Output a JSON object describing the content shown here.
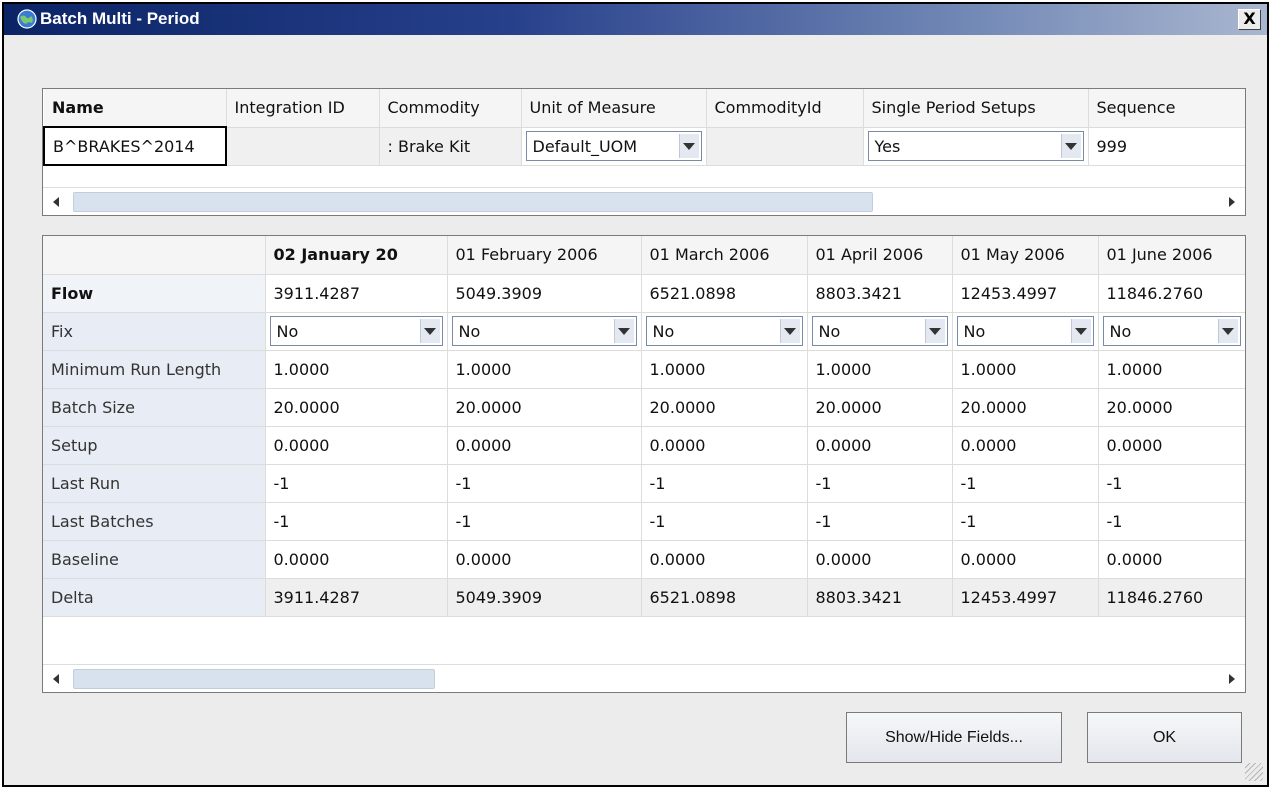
{
  "window": {
    "title": "Batch Multi - Period",
    "close_label": "X"
  },
  "item_grid": {
    "headers": [
      "Name",
      "Integration ID",
      "Commodity",
      "Unit of Measure",
      "CommodityId",
      "Single Period Setups",
      "Sequence"
    ],
    "row": {
      "name": "B^BRAKES^2014",
      "integration_id": "",
      "commodity": ": Brake Kit",
      "unit_of_measure": "Default_UOM",
      "commodity_id": "",
      "single_period_setups": "Yes",
      "sequence": "999"
    }
  },
  "period_grid": {
    "columns": [
      "02 January 20",
      "01 February 2006",
      "01 March 2006",
      "01 April 2006",
      "01 May 2006",
      "01 June 2006"
    ],
    "rows": [
      {
        "label": "Flow",
        "values": [
          "3911.4287",
          "5049.3909",
          "6521.0898",
          "8803.3421",
          "12453.4997",
          "11846.2760"
        ]
      },
      {
        "label": "Fix",
        "values": [
          "No",
          "No",
          "No",
          "No",
          "No",
          "No"
        ]
      },
      {
        "label": "Minimum Run Length",
        "values": [
          "1.0000",
          "1.0000",
          "1.0000",
          "1.0000",
          "1.0000",
          "1.0000"
        ]
      },
      {
        "label": "Batch Size",
        "values": [
          "20.0000",
          "20.0000",
          "20.0000",
          "20.0000",
          "20.0000",
          "20.0000"
        ]
      },
      {
        "label": "Setup",
        "values": [
          "0.0000",
          "0.0000",
          "0.0000",
          "0.0000",
          "0.0000",
          "0.0000"
        ]
      },
      {
        "label": "Last Run",
        "values": [
          "-1",
          "-1",
          "-1",
          "-1",
          "-1",
          "-1"
        ]
      },
      {
        "label": "Last Batches",
        "values": [
          "-1",
          "-1",
          "-1",
          "-1",
          "-1",
          "-1"
        ]
      },
      {
        "label": "Baseline",
        "values": [
          "0.0000",
          "0.0000",
          "0.0000",
          "0.0000",
          "0.0000",
          "0.0000"
        ]
      },
      {
        "label": "Delta",
        "values": [
          "3911.4287",
          "5049.3909",
          "6521.0898",
          "8803.3421",
          "12453.4997",
          "11846.2760"
        ]
      }
    ]
  },
  "buttons": {
    "show_hide": "Show/Hide Fields...",
    "ok": "OK"
  },
  "icons": {
    "title": "globe-icon",
    "close": "close-icon",
    "dropdown": "chevron-down-icon",
    "scroll_left": "arrow-left-icon",
    "scroll_right": "arrow-right-icon",
    "grip": "resize-grip-icon"
  },
  "colors": {
    "title_bar": "#0b2466",
    "row_header": "#e8ecf5",
    "dialog_bg": "#ececec"
  }
}
